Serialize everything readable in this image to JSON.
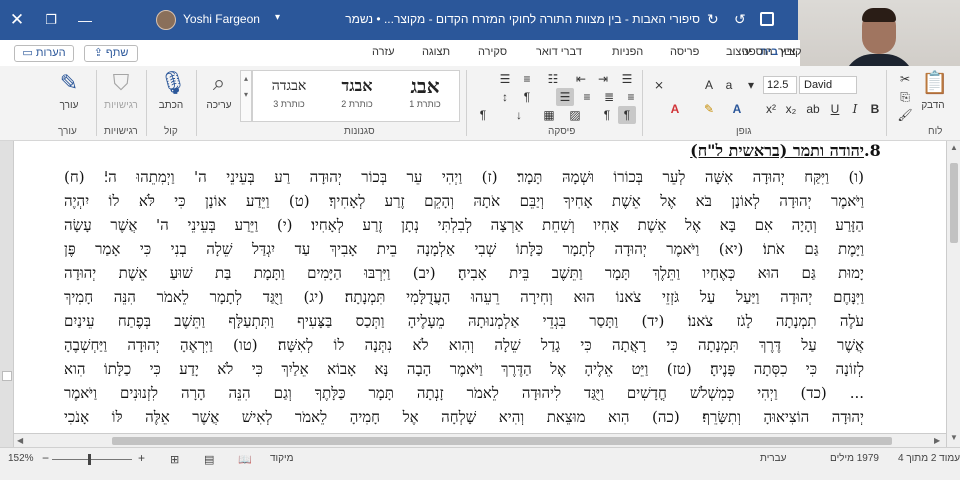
{
  "titlebar": {
    "username": "Yoshi Fargeon",
    "doc_title": "סיפורי האבות - בין מצוות התורה לחוקי המזרח הקדום - מקוצר...  •  נשמר",
    "accent": "#2b579a"
  },
  "tabs": [
    {
      "label": "קובץ"
    },
    {
      "label": "בית"
    },
    {
      "label": "הוספה"
    },
    {
      "label": "ציור"
    },
    {
      "label": "עיצוב"
    },
    {
      "label": "פריסה"
    },
    {
      "label": "הפניות"
    },
    {
      "label": "דברי דואר"
    },
    {
      "label": "סקירה"
    },
    {
      "label": "תצוגה"
    },
    {
      "label": "עזרה"
    }
  ],
  "actions": {
    "share": "שתף",
    "comments": "הערות"
  },
  "ribbon": {
    "groups": {
      "clipboard": "לוח",
      "font": "גופן",
      "paragraph": "פיסקה",
      "styles": "סגנונות",
      "voice": "קול",
      "sensitivity": "רגישויות",
      "editor": "עורך"
    },
    "paste_label": "הדבק",
    "font_name": "David",
    "font_size": "12.5",
    "styles": [
      {
        "sample": "אבג",
        "name": "כותרת 1"
      },
      {
        "sample": "אבגד",
        "name": "כותרת 2"
      },
      {
        "sample": "אבגדה",
        "name": "כותרת 3"
      }
    ],
    "editing_label": "עריכה",
    "dictate_label": "הכתב",
    "sensitivity_label": "רגישויות",
    "editor_label": "עורך"
  },
  "document": {
    "heading_number": ".8",
    "heading": "יהודה ותמר (בראשית ל\"ח)",
    "lines": [
      "(ו) וַיִּקַּח יְהוּדָה אִשָּׁה לְעֵר בְּכוֹרוֹ וּשְׁמָהּ תָּמָר׃ (ז) וַיְהִי עֵר בְּכוֹר יְהוּדָה רַע בְּעֵינֵי ה' וַיְמִתֵהוּ ה'׃ (ח)",
      "וַיֹּאמֶר יְהוּדָה לְאוֹנָן בֹּא אֶל אֵשֶׁת אָחִיךָ וְיַבֵּם אֹתָהּ וְהָקֵם זֶרַע לְאָחִיךָ׃ (ט) וַיֵּדַע אוֹנָן כִּי לֹּא לוֹ יִהְיֶה",
      "הַזָּרַע וְהָיָה אִם בָּא אֶל אֵשֶׁת אָחִיו וְשִׁחֵת אַרְצָה לְבִלְתִּי נְתָן זֶרַע לְאָחִיו׃ (י) וַיֵּרַע בְּעֵינֵי ה' אֲשֶׁר עָשָׂה",
      "וַיָּמֶת גַּם אֹתוֹ׃ (יא) וַיֹּאמֶר יְהוּדָה לְתָמָר כַּלָּתוֹ שְׁבִי אַלְמָנָה בֵית אָבִיךְ עַד יִגְדַּל שֵׁלָה בְנִי כִּי אָמַר פֶּן",
      "יָמוּת גַּם הוּא כְּאֶחָיו וַתֵּלֶךְ תָּמָר וַתֵּשֶׁב בֵּית אָבִיהָ׃ (יב) וַיִּרְבּוּ הַיָּמִים וַתָּמָת בַּת שׁוּעַ אֵשֶׁת יְהוּדָה",
      "וַיִּנָּחֶם יְהוּדָה וַיַּעַל עַל גֹּזְזֵי צֹאנוֹ הוּא וְחִירָה רֵעֵהוּ הָעֲדֻלָּמִי תִּמְנָתָה׃ (יג) וַיֻּגַּד לְתָמָר לֵאמֹר הִנֵּה חָמִיךְ",
      "עֹלֶה תִמְנָתָה לָגֹז צֹאנוֹ׃ (יד) וַתָּסַר בִּגְדֵי אַלְמְנוּתָהּ מֵעָלֶיהָ וַתְּכַס בַּצָּעִיף וַתִּתְעַלָּף וַתֵּשֶׁב בְּפֶתַח עֵינַיִם",
      "אֲשֶׁר עַל דֶּרֶךְ תִּמְנָתָה כִּי רָאֲתָה כִּי גָדַל שֵׁלָה וְהִוא לֹא נִתְּנָה לוֹ לְאִשָּׁה׃ (טו) וַיִּרְאֶהָ יְהוּדָה וַיַּחְשְׁבֶהָ",
      "לְזוֹנָה כִּי כִסְּתָה פָּנֶיהָ׃ (טז) וַיֵּט אֵלֶיהָ אֶל הַדֶּרֶךְ וַיֹּאמֶר הָבָה נָּא אָבוֹא אֵלַיִךְ כִּי לֹא יָדַע כִּי כַלָּתוֹ הִוא",
      "... (כד) וַיְהִי כְּמִשְׁלֹשׁ חֳדָשִׁים וַיֻּגַּד לִיהוּדָה לֵאמֹר זָנְתָה תָּמָר כַּלָּתֶךָ וְגַם הִנֵּה הָרָה לִזְנוּנִים וַיֹּאמֶר",
      "יְהוּדָה הוֹצִיאוּהָ וְתִשָּׂרֵף׃ (כה) הִוא מוּצֵאת וְהִיא שָׁלְחָה אֶל חָמִיהָ לֵאמֹר לְאִישׁ אֲשֶׁר אֵלֶּה לּוֹ אָנֹכִי"
    ]
  },
  "statusbar": {
    "page": "עמוד 2 מתוך 4",
    "words": "1979 מילים",
    "language": "עברית",
    "focus": "מיקוד",
    "zoom": "152%",
    "zoom_minus": "−",
    "zoom_plus": "+"
  }
}
